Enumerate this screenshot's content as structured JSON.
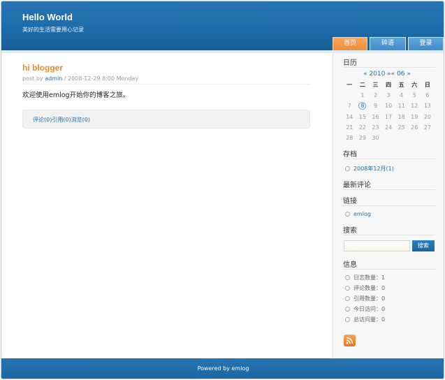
{
  "header": {
    "title": "Hello World",
    "subtitle": "美好的生活需要用心记录",
    "nav": [
      "首页",
      "碎语",
      "登录"
    ]
  },
  "post": {
    "title": "hi blogger",
    "meta_prefix": "post by",
    "author": "admin",
    "meta_suffix": "/ 2008-12-29 8:00 Monday",
    "body": "欢迎使用emlog开始你的博客之旅。",
    "footer_links": [
      "评论(0)",
      "引用(0)",
      "浏览(0)"
    ]
  },
  "sidebar": {
    "calendar": {
      "title": "日历",
      "prev": "«",
      "year": "2010",
      "mid": "»«",
      "month": "06",
      "next": "»",
      "weekdays": [
        "一",
        "二",
        "三",
        "四",
        "五",
        "六",
        "日"
      ],
      "weeks": [
        [
          "",
          "1",
          "2",
          "3",
          "4",
          "5",
          "6"
        ],
        [
          "7",
          "8",
          "9",
          "10",
          "11",
          "12",
          "13"
        ],
        [
          "14",
          "15",
          "16",
          "17",
          "18",
          "19",
          "20"
        ],
        [
          "21",
          "22",
          "23",
          "24",
          "25",
          "26",
          "27"
        ],
        [
          "28",
          "29",
          "30",
          "",
          "",
          "",
          ""
        ]
      ],
      "today": "8"
    },
    "archive": {
      "title": "存档",
      "items": [
        "2008年12月(1)"
      ]
    },
    "latest_comments": {
      "title": "最新评论"
    },
    "links": {
      "title": "链接",
      "items": [
        "emlog"
      ]
    },
    "search": {
      "title": "搜索",
      "button": "搜索",
      "value": ""
    },
    "info": {
      "title": "信息",
      "items": [
        "日志数量：1",
        "评论数量：0",
        "引用数量：0",
        "今日访问：0",
        "总访问量：0"
      ]
    },
    "rss_icon": "rss-icon"
  },
  "footer": {
    "text": "Powered by emlog"
  },
  "colors": {
    "brand": "#1d6cab",
    "accent": "#f08c37",
    "title_orange": "#ee8a2b"
  }
}
